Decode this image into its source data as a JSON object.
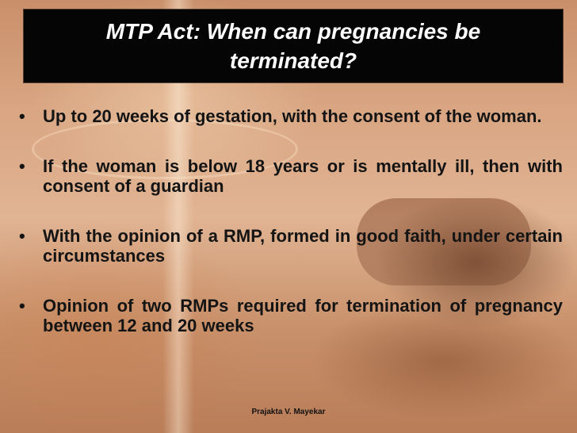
{
  "title": "MTP Act: When can pregnancies be terminated?",
  "bullets": [
    "Up to 20 weeks of gestation, with the consent of the woman.",
    "If the woman is below 18 years or is mentally ill, then with consent of a guardian",
    "With the opinion of a RMP, formed in good faith, under certain circumstances",
    "Opinion of two RMPs required for termination of pregnancy between 12 and 20 weeks"
  ],
  "bullet_symbol": "•",
  "footer": "Prajakta V. Mayekar",
  "colors": {
    "title_background": "#050505",
    "title_text": "#ffffff",
    "body_text": "#141414"
  }
}
